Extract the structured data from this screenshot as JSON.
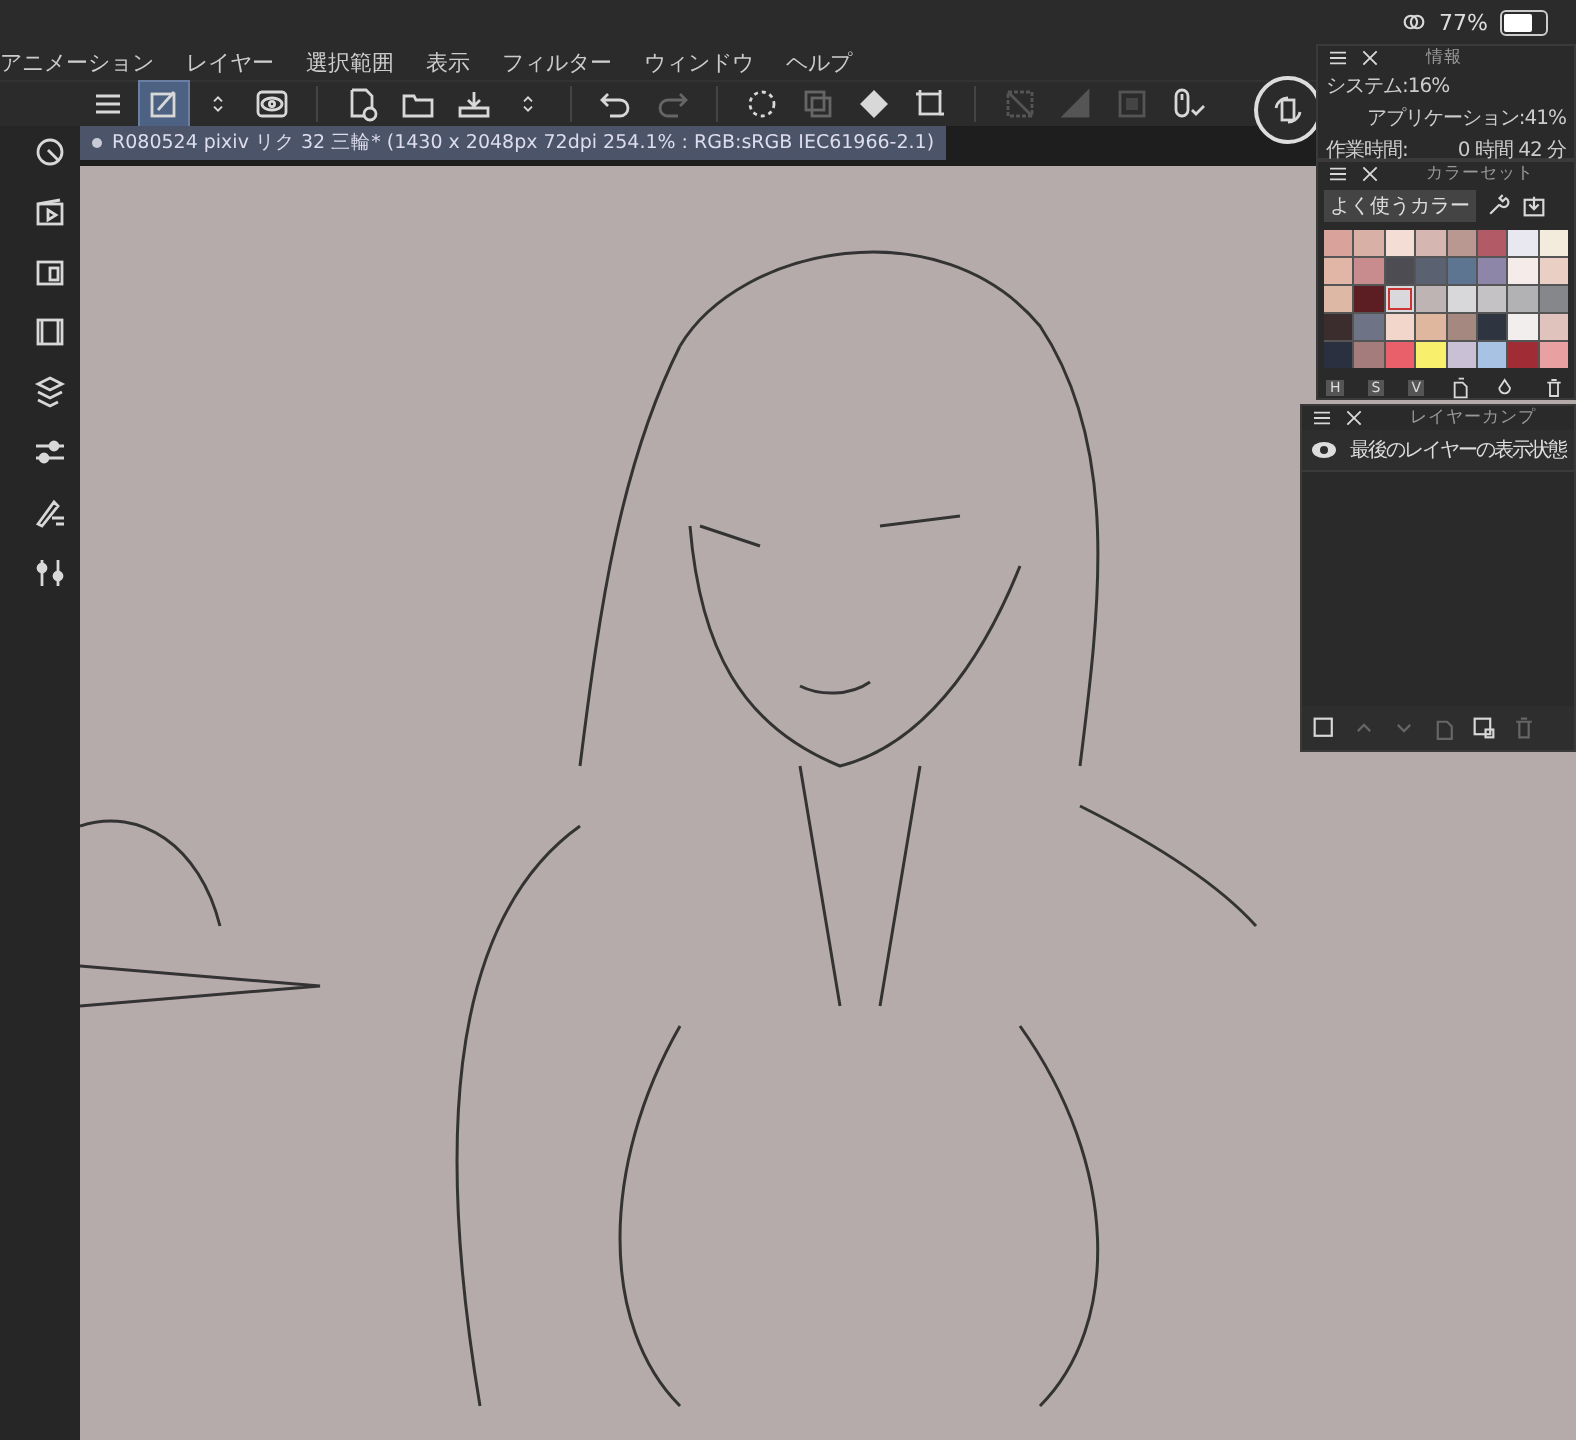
{
  "status_bar": {
    "battery": "77%"
  },
  "menu": [
    "アニメーション",
    "レイヤー",
    "選択範囲",
    "表示",
    "フィルター",
    "ウィンドウ",
    "ヘルプ"
  ],
  "toolbar": [
    {
      "kind": "menu",
      "selected": false
    },
    {
      "kind": "pen",
      "selected": true
    },
    {
      "kind": "updown",
      "selected": false
    },
    {
      "kind": "eye",
      "selected": false
    },
    {
      "kind": "divider"
    },
    {
      "kind": "new",
      "selected": false
    },
    {
      "kind": "open",
      "selected": false
    },
    {
      "kind": "save",
      "selected": false
    },
    {
      "kind": "updown",
      "selected": false
    },
    {
      "kind": "divider"
    },
    {
      "kind": "undo",
      "selected": false
    },
    {
      "kind": "redo",
      "selected": false
    },
    {
      "kind": "divider"
    },
    {
      "kind": "dots",
      "selected": false
    },
    {
      "kind": "copy",
      "selected": false
    },
    {
      "kind": "fill",
      "selected": false
    },
    {
      "kind": "crop",
      "selected": false
    },
    {
      "kind": "divider"
    },
    {
      "kind": "nocrop",
      "selected": false
    },
    {
      "kind": "tone",
      "selected": false
    },
    {
      "kind": "square",
      "selected": false
    },
    {
      "kind": "mouse",
      "selected": false
    }
  ],
  "document_tab": {
    "title": "R080524 pixiv リク 32 三輪* (1430 x 2048px 72dpi 254.1% : RGB:sRGB IEC61966-2.1)"
  },
  "info_panel": {
    "title": "情報",
    "system": "システム:16%",
    "application": "アプリケーション:41%",
    "work_time_label": "作業時間:",
    "work_time": "0 時間 42 分"
  },
  "color_set": {
    "title": "カラーセット",
    "set_name": "よく使うカラー",
    "modes": [
      "H",
      "S",
      "V"
    ],
    "swatches": [
      {
        "color": "#d9a39c",
        "selected": false
      },
      {
        "color": "#d8b0a6",
        "selected": false
      },
      {
        "color": "#f3ddd5",
        "selected": false
      },
      {
        "color": "#d6b6b0",
        "selected": false
      },
      {
        "color": "#b99892",
        "selected": false
      },
      {
        "color": "#b25a66",
        "selected": false
      },
      {
        "color": "#e9e8f0",
        "selected": false
      },
      {
        "color": "#f3ecdc",
        "selected": false
      },
      {
        "color": "#e2b6a6",
        "selected": false
      },
      {
        "color": "#c88c8f",
        "selected": false
      },
      {
        "color": "#4d4c52",
        "selected": false
      },
      {
        "color": "#5a6170",
        "selected": false
      },
      {
        "color": "#5d7590",
        "selected": false
      },
      {
        "color": "#8e86a8",
        "selected": false
      },
      {
        "color": "#f5ecea",
        "selected": false
      },
      {
        "color": "#e9cfc4",
        "selected": false
      },
      {
        "color": "#ddb8a4",
        "selected": false
      },
      {
        "color": "#5c1e22",
        "selected": false
      },
      {
        "color": "#d9d8dc",
        "selected": true
      },
      {
        "color": "#bfb4b4",
        "selected": false
      },
      {
        "color": "#d8d8da",
        "selected": false
      },
      {
        "color": "#c4c2c4",
        "selected": false
      },
      {
        "color": "#b2b2b4",
        "selected": false
      },
      {
        "color": "#85878a",
        "selected": false
      },
      {
        "color": "#3b2d2d",
        "selected": false
      },
      {
        "color": "#6e7386",
        "selected": false
      },
      {
        "color": "#f2d6cc",
        "selected": false
      },
      {
        "color": "#dfb79e",
        "selected": false
      },
      {
        "color": "#a58880",
        "selected": false
      },
      {
        "color": "#2f3540",
        "selected": false
      },
      {
        "color": "#f2eeee",
        "selected": false
      },
      {
        "color": "#e0c3bc",
        "selected": false
      },
      {
        "color": "#2a3040",
        "selected": false
      },
      {
        "color": "#a47c7c",
        "selected": false
      },
      {
        "color": "#e9606a",
        "selected": false
      },
      {
        "color": "#f8f06c",
        "selected": false
      },
      {
        "color": "#c9c0d6",
        "selected": false
      },
      {
        "color": "#a8c2e4",
        "selected": false
      },
      {
        "color": "#a02c36",
        "selected": false
      },
      {
        "color": "#e8a0a0",
        "selected": false
      }
    ]
  },
  "layer_comp": {
    "title": "レイヤーカンプ",
    "items": [
      {
        "label": "最後のレイヤーの表示状態",
        "visible": true
      }
    ]
  }
}
